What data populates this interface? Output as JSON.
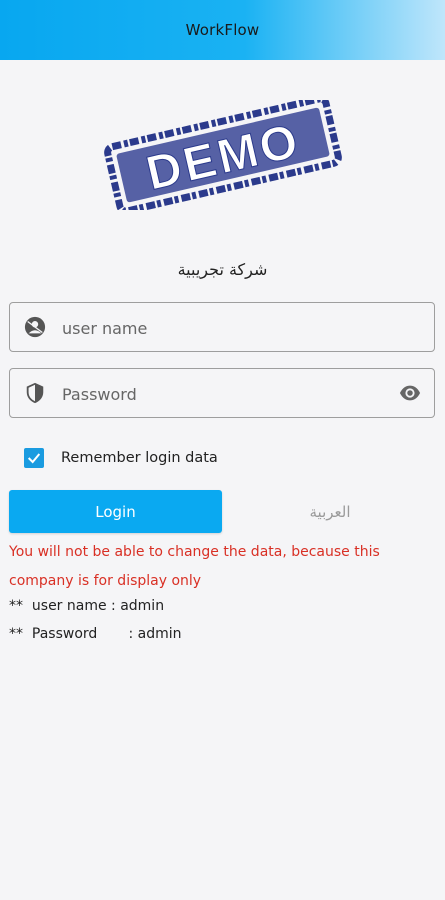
{
  "appbar": {
    "title": "WorkFlow"
  },
  "stamp": {
    "text": "DEMO",
    "color": "#2b3a8c"
  },
  "company_name": "شركة تجريبية",
  "username": {
    "placeholder": "user name",
    "icon": "user-circle-icon"
  },
  "password": {
    "placeholder": "Password",
    "icon": "shield-icon",
    "toggle_icon": "eye-icon"
  },
  "remember": {
    "label": "Remember login data",
    "checked": true
  },
  "buttons": {
    "login": "Login",
    "language": "العربية"
  },
  "notice": {
    "warning": "You will not be able to change the data, because this company is for display only",
    "username_line": "**  user name : admin",
    "password_line": "**  Password       : admin"
  },
  "colors": {
    "accent": "#0aa9f1",
    "error": "#d93025",
    "checkbox": "#1a9be0"
  }
}
